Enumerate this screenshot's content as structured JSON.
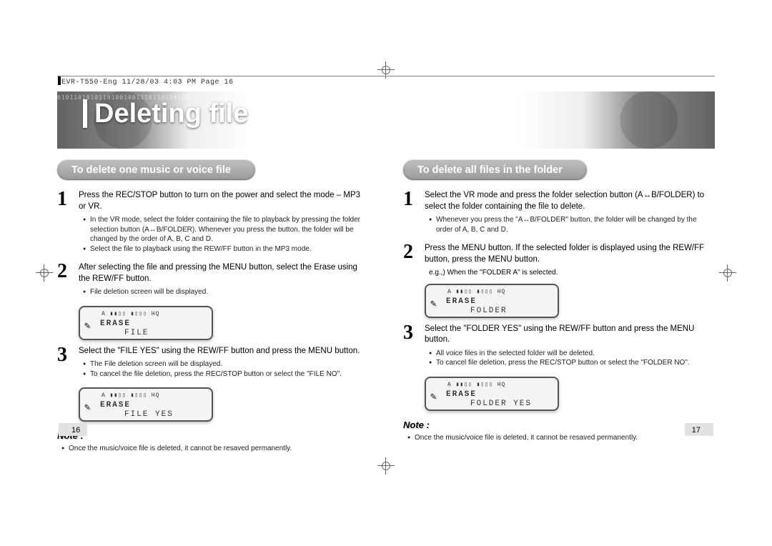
{
  "meta": {
    "header": "EVR-T550-Eng  11/28/03  4:03 PM  Page 16"
  },
  "hero": {
    "binary": "0101101010110100100111011010010101110100100100110110101010100100100111010110110100100100",
    "title": "Deleting file"
  },
  "left": {
    "pill": "To delete one music or voice file",
    "step1": {
      "num": "1",
      "text": "Press the REC/STOP button to turn on the power and select the mode – MP3 or VR.",
      "b1": "In the VR mode, select the folder containing the file to playback by pressing the folder selection button (A↔B/FOLDER). Whenever you press the button, the folder will be changed by the order of A, B, C and D.",
      "b2": "Select the file to playback using the REW/FF button in the MP3 mode."
    },
    "step2": {
      "num": "2",
      "text": "After selecting the file and pressing the MENU button, select the Erase using the REW/FF button.",
      "b1": "File deletion screen will be displayed."
    },
    "lcd1": {
      "top": "A  ▮▮▯▯ ▮▯▯▯ HQ",
      "icon": "✎",
      "l1": "ERASE",
      "l2": "FILE"
    },
    "step3": {
      "num": "3",
      "text": "Select the \"FILE YES\" using the REW/FF button and press the MENU button.",
      "b1": "The File deletion screen will be displayed.",
      "b2": "To cancel the file deletion, press the REC/STOP button or select the \"FILE NO\"."
    },
    "lcd2": {
      "top": "A  ▮▮▯▯ ▮▯▯▯ HQ",
      "icon": "✎",
      "l1": "ERASE",
      "l2": "FILE YES"
    },
    "noteH": "Note :",
    "noteB": "Once the music/voice file is deleted, it cannot be resaved permanently."
  },
  "right": {
    "pill": "To delete all files in the folder",
    "step1": {
      "num": "1",
      "text": "Select the VR mode and press the folder selection button (A↔B/FOLDER) to select the folder containing the file to delete.",
      "b1": "Whenever you press the \"A↔B/FOLDER\" button, the folder will be changed by the order of A, B, C and D."
    },
    "step2": {
      "num": "2",
      "text": "Press the MENU button. If the selected folder is displayed using the REW/FF button, press the MENU button.",
      "eg": "e.g.,) When the \"FOLDER A\" is selected."
    },
    "lcd1": {
      "top": "A  ▮▮▯▯ ▮▯▯▯ HQ",
      "icon": "✎",
      "l1": "ERASE",
      "l2": "FOLDER"
    },
    "step3": {
      "num": "3",
      "text": "Select the \"FOLDER YES\" using the REW/FF button and press the MENU button.",
      "b1": "All voice files in the selected folder will be deleted.",
      "b2": "To cancel file deletion, press the REC/STOP button or select the \"FOLDER NO\"."
    },
    "lcd2": {
      "top": "A  ▮▮▯▯ ▮▯▯▯ HQ",
      "icon": "✎",
      "l1": "ERASE",
      "l2": "FOLDER YES"
    },
    "noteH": "Note :",
    "noteB": "Once the music/voice file is deleted, it cannot be resaved permanently."
  },
  "pages": {
    "left": "16",
    "right": "17"
  }
}
